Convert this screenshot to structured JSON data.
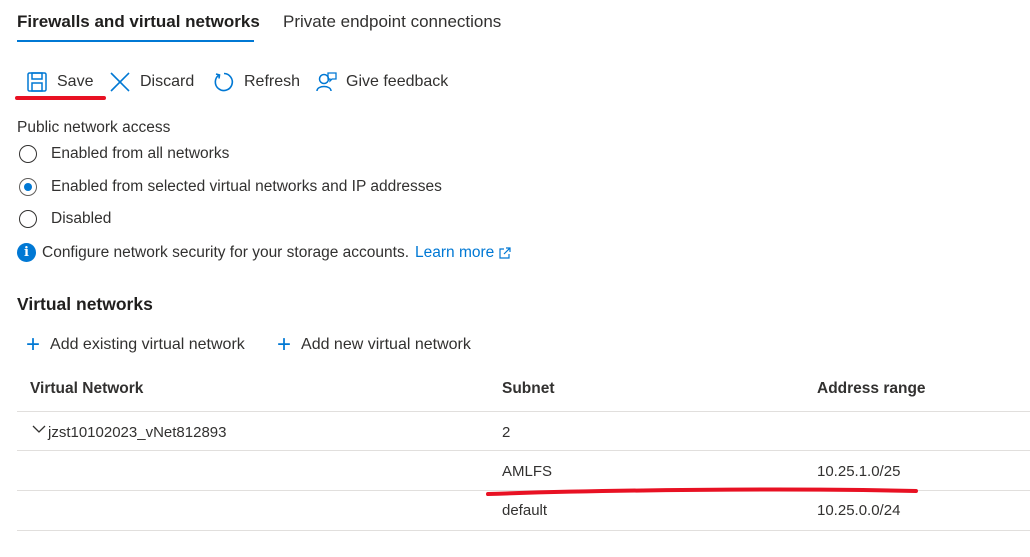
{
  "tabs": [
    {
      "label": "Firewalls and virtual networks"
    },
    {
      "label": "Private endpoint connections"
    }
  ],
  "toolbar": {
    "save_label": "Save",
    "discard_label": "Discard",
    "refresh_label": "Refresh",
    "feedback_label": "Give feedback"
  },
  "public_access": {
    "label": "Public network access",
    "options": [
      {
        "label": "Enabled from all networks",
        "selected": false
      },
      {
        "label": "Enabled from selected virtual networks and IP addresses",
        "selected": true
      },
      {
        "label": "Disabled",
        "selected": false
      }
    ],
    "info_text": "Configure network security for your storage accounts.",
    "learn_more": "Learn more"
  },
  "vnets": {
    "title": "Virtual networks",
    "add_existing": "Add existing virtual network",
    "add_new": "Add new virtual network",
    "columns": [
      "Virtual Network",
      "Subnet",
      "Address range"
    ],
    "rows": [
      {
        "vnet": "jzst10102023_vNet812893",
        "subnet": "2",
        "range": ""
      },
      {
        "vnet": "",
        "subnet": "AMLFS",
        "range": "10.25.1.0/25"
      },
      {
        "vnet": "",
        "subnet": "default",
        "range": "10.25.0.0/24"
      }
    ]
  },
  "colors": {
    "accent": "#0078d4",
    "annotation_red": "#e81123"
  }
}
